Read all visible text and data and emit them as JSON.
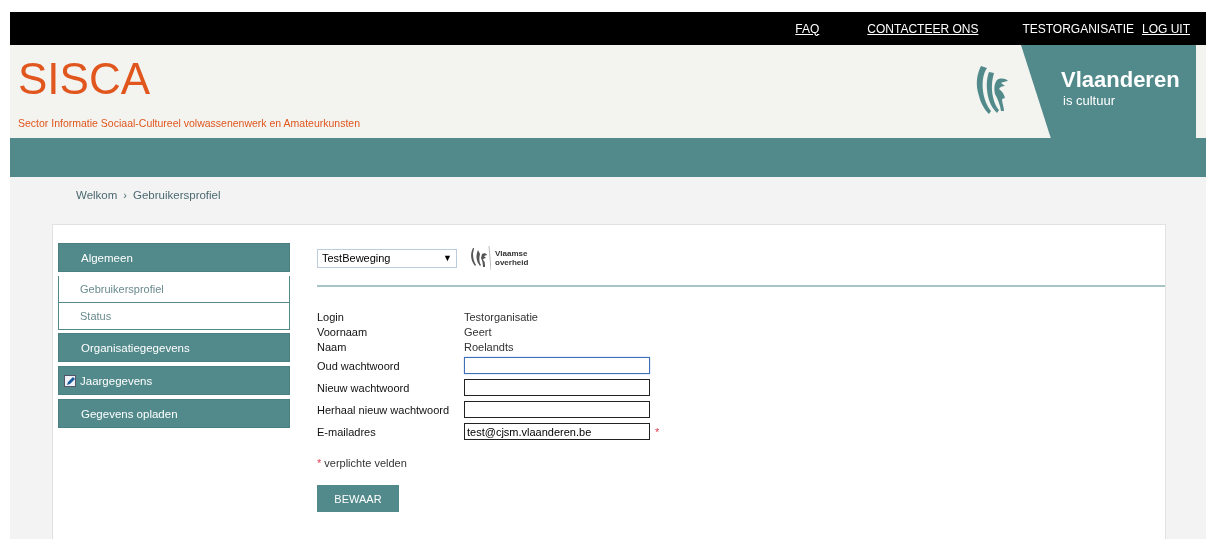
{
  "top_links": [
    {
      "label": "FAQ",
      "kind": "link"
    },
    {
      "label": "CONTACTEER ONS",
      "kind": "link"
    },
    {
      "label": "TESTORGANISATIE",
      "kind": "text"
    },
    {
      "label": "LOG UIT",
      "kind": "link"
    }
  ],
  "header": {
    "title": "SISCA",
    "subtitle": "Sector Informatie Sociaal-Cultureel volwassenenwerk en Amateurkunsten",
    "brand": "Vlaanderen",
    "tagline": "is cultuur"
  },
  "breadcrumb": [
    "Welkom",
    "›",
    "Gebruikersprofiel"
  ],
  "sidebar": {
    "items": [
      {
        "label": "Algemeen",
        "kind": "section",
        "edit_icon": false
      },
      {
        "label": "Gebruikersprofiel",
        "kind": "sub"
      },
      {
        "label": "Status",
        "kind": "sub"
      },
      {
        "label": "Organisatiegegevens",
        "kind": "section",
        "edit_icon": false
      },
      {
        "label": "Jaargegevens",
        "kind": "section",
        "edit_icon": true
      },
      {
        "label": "Gegevens opladen",
        "kind": "section",
        "edit_icon": false
      }
    ]
  },
  "organisation_select": {
    "value": "TestBeweging",
    "arrow": "▼"
  },
  "gov_logo": {
    "line1": "Vlaamse",
    "line2": "overheid"
  },
  "form": {
    "rows": [
      {
        "label": "Login",
        "kind": "text",
        "value": "Testorganisatie"
      },
      {
        "label": "Voornaam",
        "kind": "text",
        "value": "Geert"
      },
      {
        "label": "Naam",
        "kind": "text",
        "value": "Roelandts"
      },
      {
        "label": "Oud wachtwoord",
        "kind": "input",
        "focused": true
      },
      {
        "label": "Nieuw wachtwoord",
        "kind": "input",
        "focused": false
      },
      {
        "label": "Herhaal nieuw wachtwoord",
        "kind": "input",
        "focused": false
      },
      {
        "label": "E-mailadres",
        "kind": "input",
        "focused": false,
        "value": "test@cjsm.vlaanderen.be",
        "required_mark": "*"
      }
    ],
    "legend_mark": "*",
    "legend": "verplichte velden",
    "save_button": "BEWAAR"
  }
}
